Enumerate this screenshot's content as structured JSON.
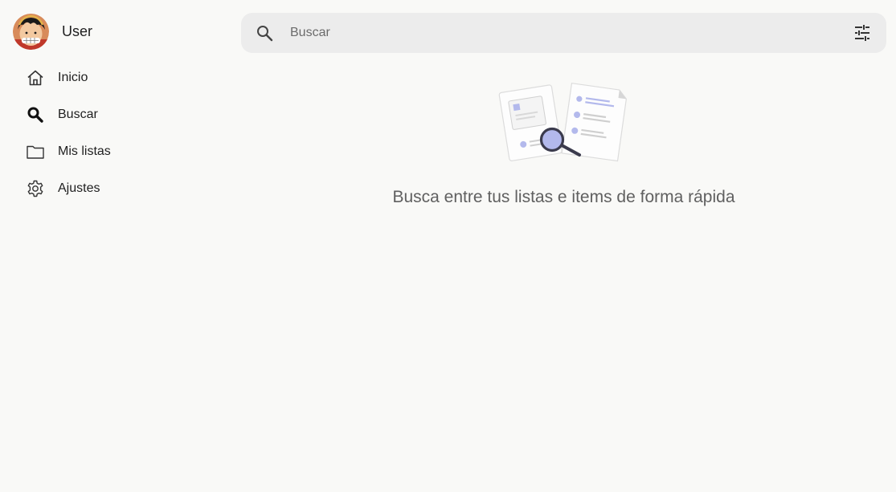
{
  "user": {
    "name": "User"
  },
  "nav": {
    "items": [
      {
        "label": "Inicio",
        "icon": "home-icon"
      },
      {
        "label": "Buscar",
        "icon": "search-icon"
      },
      {
        "label": "Mis listas",
        "icon": "folder-icon"
      },
      {
        "label": "Ajustes",
        "icon": "gear-icon"
      }
    ]
  },
  "search": {
    "placeholder": "Buscar",
    "value": ""
  },
  "empty_state": {
    "message": "Busca entre tus listas e items de forma rápida"
  },
  "colors": {
    "background": "#f9f9f7",
    "search_bar": "#ececec",
    "illustration_accent": "#b3b9ec"
  }
}
